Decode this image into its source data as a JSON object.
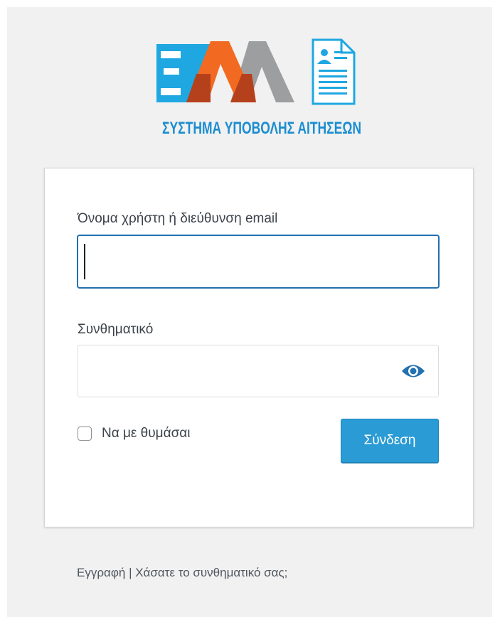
{
  "logo": {
    "caption": "ΣΥΣΤΗΜΑ ΥΠΟΒΟΛΗΣ ΑΙΤΗΣΕΩΝ",
    "colors": {
      "blue": "#1ea7e1",
      "orange": "#f26a21",
      "dark_orange": "#b5411c",
      "gray": "#9c9ea0",
      "caption": "#1b8dd0"
    }
  },
  "login_form": {
    "username_label": "Όνομα χρήστη ή διεύθυνση email",
    "username_value": "",
    "password_label": "Συνθηματικό",
    "password_value": "",
    "show_password_icon": "eye-icon",
    "remember_me_label": "Να με θυμάσαι",
    "remember_me_checked": false,
    "submit_label": "Σύνδεση"
  },
  "nav": {
    "register_link": "Εγγραφή",
    "separator": "|",
    "lost_password_link": "Χάσατε το συνθηματικό σας;"
  },
  "colors": {
    "page_background": "#f1f1f1",
    "primary_button": "#2a9bd4",
    "focus_border": "#2271b1",
    "eye_icon": "#2271b1",
    "text": "#3c434a"
  }
}
